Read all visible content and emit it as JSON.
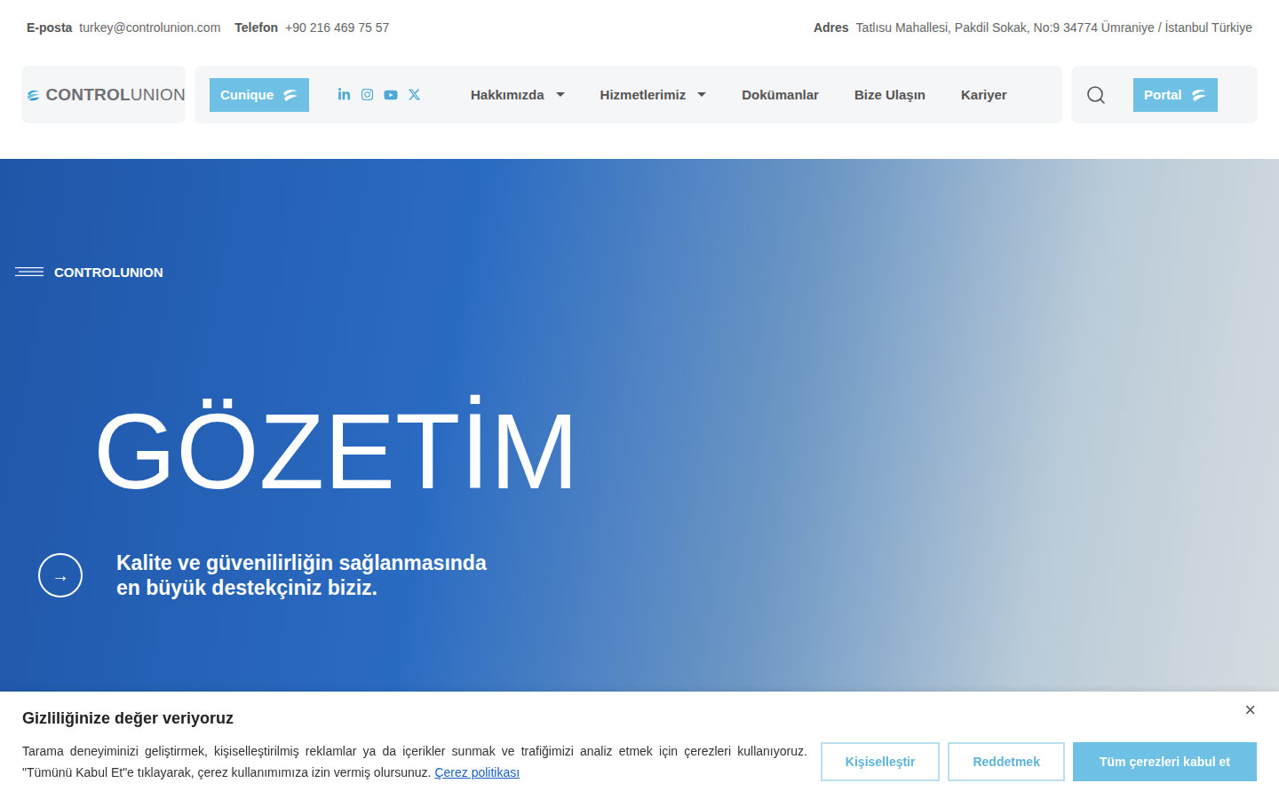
{
  "topbar": {
    "email_label": "E-posta",
    "email": "turkey@controlunion.com",
    "phone_label": "Telefon",
    "phone": "+90 216 469 75 57",
    "address_label": "Adres",
    "address": "Tatlısu Mahallesi, Pakdil Sokak, No:9 34774 Ümraniye / İstanbul Türkiye"
  },
  "logo": {
    "bold": "CONTROL",
    "light": "UNION"
  },
  "cunique": "Cunique",
  "menu": [
    {
      "label": "Hakkımızda",
      "dropdown": true
    },
    {
      "label": "Hizmetlerimiz",
      "dropdown": true
    },
    {
      "label": "Dokümanlar",
      "dropdown": false
    },
    {
      "label": "Bize Ulaşın",
      "dropdown": false
    },
    {
      "label": "Kariyer",
      "dropdown": false
    }
  ],
  "portal": "Portal",
  "hero": {
    "tag": "CONTROLUNION",
    "title": "GÖZETİM",
    "arrow": "→",
    "subtitle_lines": [
      "Kalite ve güvenilirliğin sağlanmasında",
      "en büyük destekçiniz biziz."
    ]
  },
  "cookie": {
    "title": "Gizliliğinize değer veriyoruz",
    "body": "Tarama deneyiminizi geliştirmek, kişiselleştirilmiş reklamlar ya da içerikler sunmak ve trafiğimizi analiz etmek için çerezleri kullanıyoruz. \"Tümünü Kabul Et\"e tıklayarak, çerez kullanımımıza izin vermiş olursunuz.",
    "link": "Çerez politikası",
    "close": "×",
    "buttons": [
      {
        "label": "Kişiselleştir",
        "primary": false
      },
      {
        "label": "Reddetmek",
        "primary": false
      },
      {
        "label": "Tüm çerezleri kabul et",
        "primary": true
      }
    ]
  }
}
